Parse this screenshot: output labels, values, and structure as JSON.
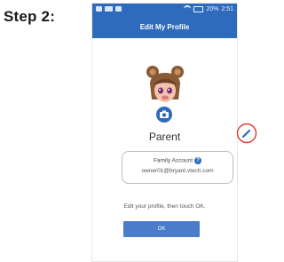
{
  "step": {
    "label": "Step 2:"
  },
  "status_bar": {
    "battery_text": "20%",
    "time": "2:51",
    "icons": [
      "notification-icon",
      "notification-icon",
      "notification-icon",
      "wifi-icon",
      "battery-icon"
    ]
  },
  "header": {
    "title": "Edit My Profile"
  },
  "profile": {
    "name": "Parent",
    "avatar_icon": "bear-avatar-icon",
    "camera_icon": "camera-icon",
    "edit_icon": "pencil-icon"
  },
  "account": {
    "title": "Family Account",
    "help_icon": "?",
    "email": "owner01@bryant.vtech.com"
  },
  "instruction": "Edit your profile, then touch OK.",
  "actions": {
    "ok_label": "OK"
  },
  "colors": {
    "header": "#2f6bbd",
    "button": "#4a7cc9",
    "annotation": "#d93a2b"
  }
}
